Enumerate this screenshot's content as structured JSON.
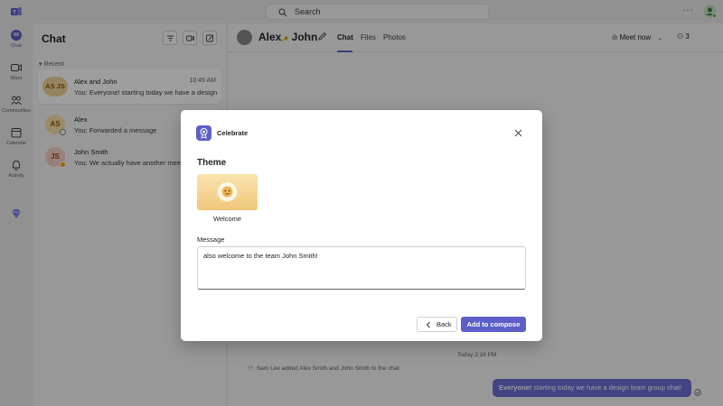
{
  "topbar": {
    "search_placeholder": "Search"
  },
  "rail": {
    "items": [
      {
        "label": "Chat",
        "icon": "chat-icon",
        "active": true
      },
      {
        "label": "Meet",
        "icon": "video-icon"
      },
      {
        "label": "Communities",
        "icon": "communities-icon"
      },
      {
        "label": "Calendar",
        "icon": "calendar-icon"
      },
      {
        "label": "Activity",
        "icon": "bell-icon"
      }
    ]
  },
  "chatlist": {
    "title": "Chat",
    "section": "Recent",
    "items": [
      {
        "initials": "AS JS",
        "name": "Alex and John",
        "time": "10:45 AM",
        "preview": "You: Everyone! starting today we have a design team group chat!"
      },
      {
        "initials": "AS",
        "name": "Alex",
        "time": "",
        "preview": "You: Forwarded a message"
      },
      {
        "initials": "JS",
        "name": "John Smith",
        "time": "",
        "preview": "You: We actually have another meeting"
      }
    ]
  },
  "main": {
    "title_a": "Alex",
    "title_b": "John",
    "tabs": [
      "Chat",
      "Files",
      "Photos"
    ],
    "meet_now": "Meet now",
    "participants": "3",
    "timestamp": "Today 2:16 PM",
    "system_message": "Sam Lee added Alex Smith and John Smith to the chat.",
    "bubble_bold": "Everyone!",
    "bubble_rest": " starting today we have a design team group chat!"
  },
  "modal": {
    "title": "Celebrate",
    "theme_heading": "Theme",
    "theme_name": "Welcome",
    "message_label": "Message",
    "message_value": "also welcome to the team John Smith!",
    "back_label": "Back",
    "add_label": "Add to compose"
  },
  "colors": {
    "accent": "#5b5fc7",
    "bubble": "#6b6fd6"
  }
}
